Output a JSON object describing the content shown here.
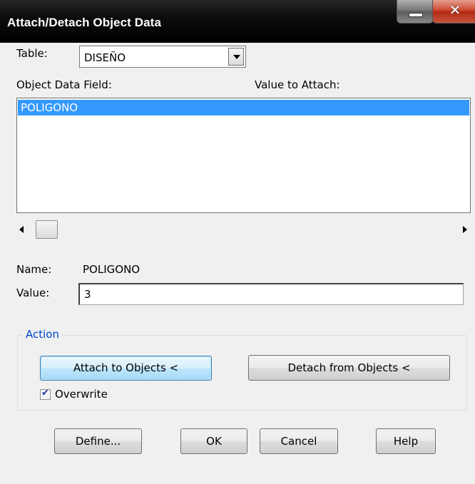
{
  "window": {
    "title": "Attach/Detach Object Data",
    "minimize_icon": "minimize-icon",
    "close_icon": "close-icon",
    "close_glyph": "✕"
  },
  "table": {
    "label": "Table:",
    "selected": "DISEÑO"
  },
  "list": {
    "col_field": "Object Data Field:",
    "col_value": "Value to Attach:",
    "items": [
      "POLIGONO"
    ],
    "selected_index": 0
  },
  "name": {
    "label": "Name:",
    "value": "POLIGONO"
  },
  "value": {
    "label": "Value:",
    "input": "3"
  },
  "action": {
    "legend": "Action",
    "attach_label": "Attach to Objects <",
    "detach_label": "Detach from Objects <",
    "overwrite_label": "Overwrite",
    "overwrite_checked": true
  },
  "buttons": {
    "define": "Define...",
    "ok": "OK",
    "cancel": "Cancel",
    "help": "Help"
  },
  "colors": {
    "selection": "#3399ff",
    "group_legend": "#0046d5",
    "titlebar": "#000000"
  }
}
